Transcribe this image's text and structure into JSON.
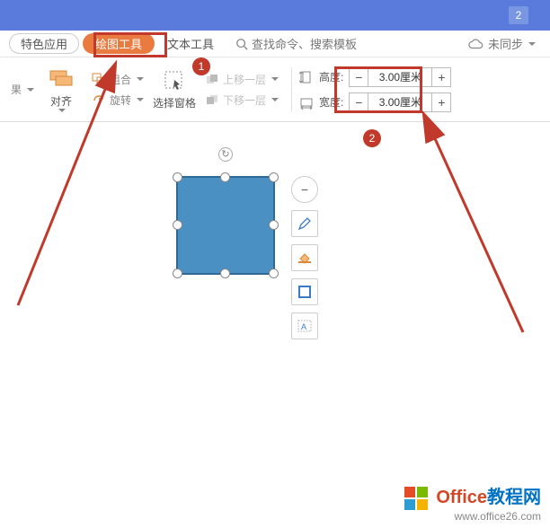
{
  "titlebar": {
    "badge": "2"
  },
  "tabs": {
    "special": "特色应用",
    "drawing_tools": "绘图工具",
    "text_tools": "文本工具",
    "search_placeholder": "查找命令、搜索模板",
    "sync": "未同步"
  },
  "ribbon": {
    "result_label": "果",
    "align": "对齐",
    "group": "组合",
    "rotate": "旋转",
    "selection_pane": "选择窗格",
    "bring_forward": "上移一层",
    "send_backward": "下移一层",
    "height_label": "高度:",
    "width_label": "宽度:",
    "height_value": "3.00厘米",
    "width_value": "3.00厘米",
    "minus": "−",
    "plus": "+"
  },
  "side_tools": {
    "collapse": "−",
    "pen": "pen-icon",
    "fill": "fill-icon",
    "outline": "outline-icon",
    "text": "text-icon"
  },
  "annotations": {
    "step1": "1",
    "step2": "2"
  },
  "watermark": {
    "brand_orange": "Office",
    "brand_blue": "教程网",
    "url": "www.office26.com"
  }
}
